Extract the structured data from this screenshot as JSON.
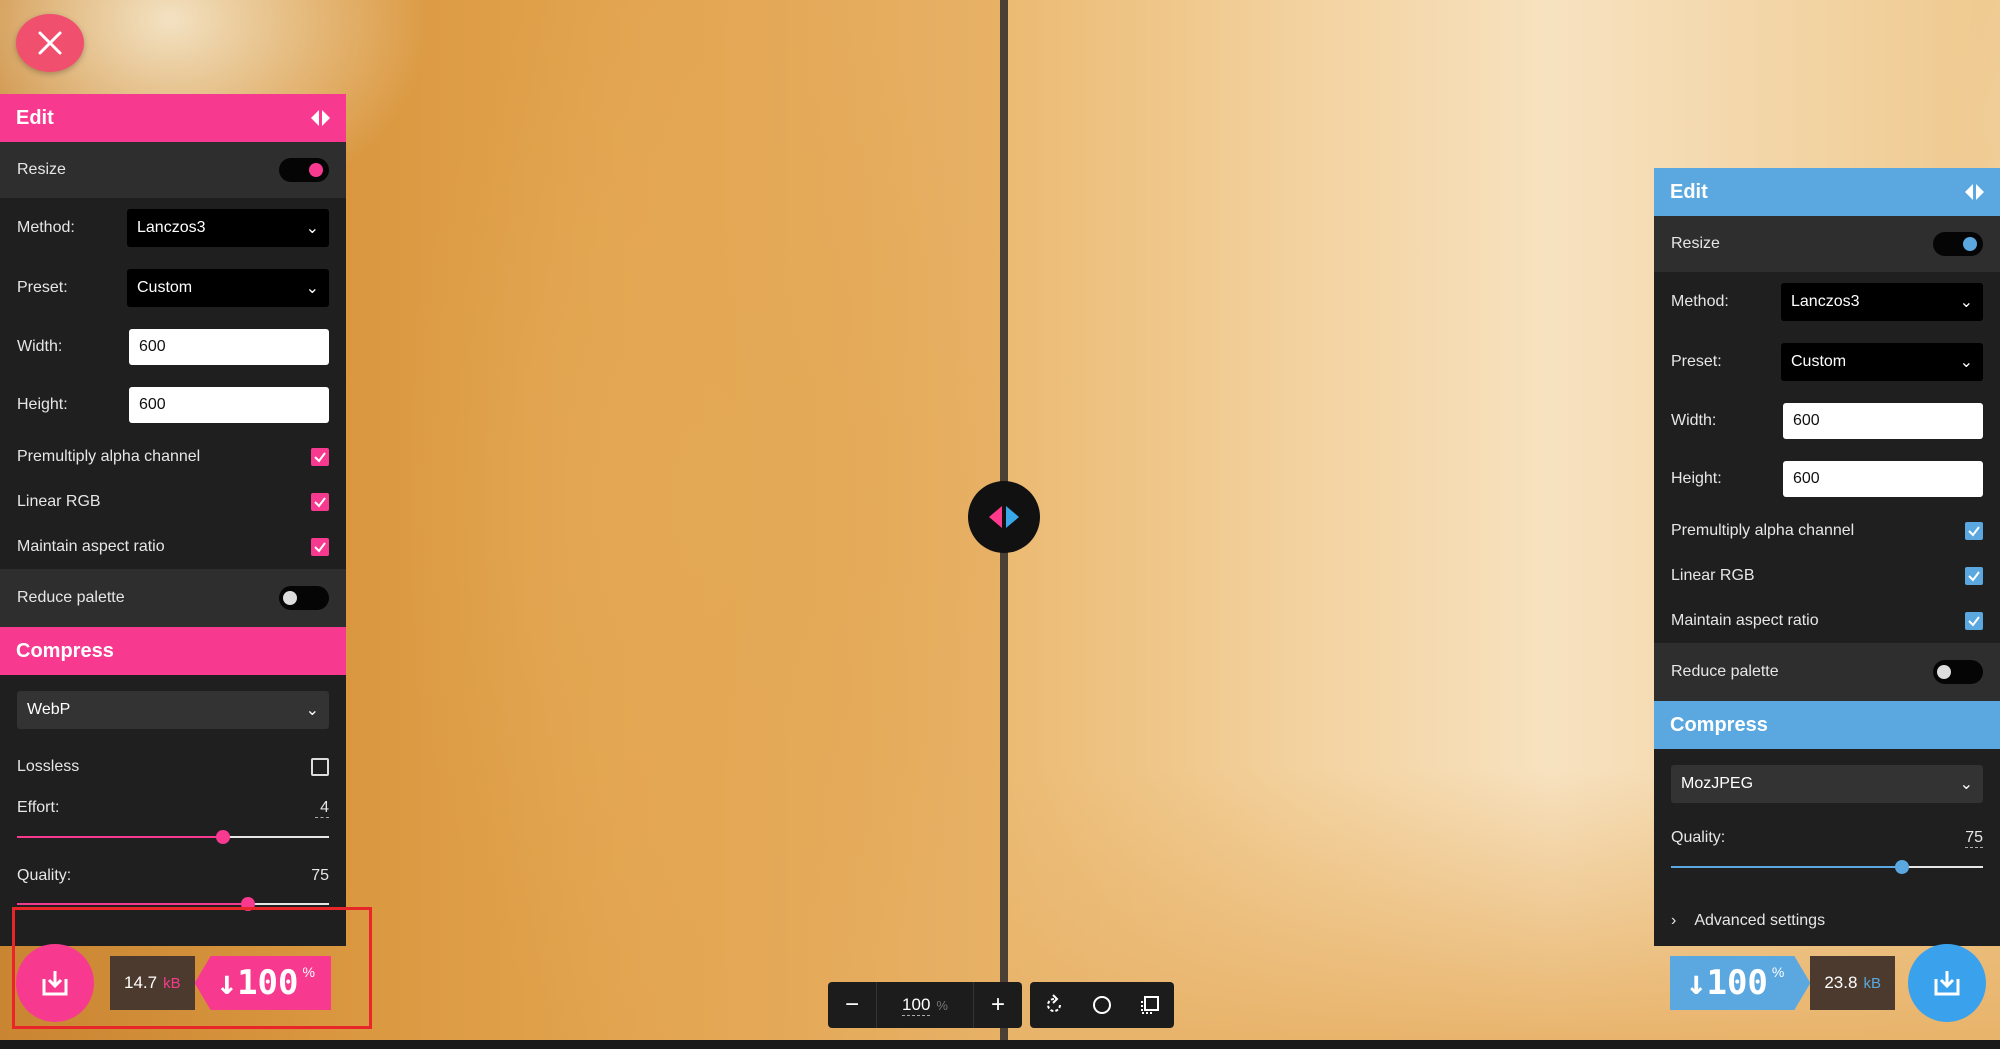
{
  "left": {
    "edit_title": "Edit",
    "resize_label": "Resize",
    "method_label": "Method:",
    "method_value": "Lanczos3",
    "preset_label": "Preset:",
    "preset_value": "Custom",
    "width_label": "Width:",
    "width_value": "600",
    "height_label": "Height:",
    "height_value": "600",
    "premultiply_label": "Premultiply alpha channel",
    "linear_rgb_label": "Linear RGB",
    "aspect_label": "Maintain aspect ratio",
    "reduce_palette_label": "Reduce palette",
    "compress_title": "Compress",
    "format_value": "WebP",
    "lossless_label": "Lossless",
    "effort_label": "Effort:",
    "effort_value": "4",
    "effort_fraction": 0.66,
    "quality_label": "Quality:",
    "quality_value": "75",
    "quality_fraction": 0.74,
    "size_value": "14.7",
    "size_unit": "kB",
    "percent_value": "↓100",
    "percent_sign": "%"
  },
  "right": {
    "edit_title": "Edit",
    "resize_label": "Resize",
    "method_label": "Method:",
    "method_value": "Lanczos3",
    "preset_label": "Preset:",
    "preset_value": "Custom",
    "width_label": "Width:",
    "width_value": "600",
    "height_label": "Height:",
    "height_value": "600",
    "premultiply_label": "Premultiply alpha channel",
    "linear_rgb_label": "Linear RGB",
    "aspect_label": "Maintain aspect ratio",
    "reduce_palette_label": "Reduce palette",
    "compress_title": "Compress",
    "format_value": "MozJPEG",
    "quality_label": "Quality:",
    "quality_value": "75",
    "quality_fraction": 0.74,
    "advanced_label": "Advanced settings",
    "size_value": "23.8",
    "size_unit": "kB",
    "percent_value": "↓100",
    "percent_sign": "%"
  },
  "zoom": {
    "minus": "−",
    "value": "100",
    "unit": "%",
    "plus": "+"
  },
  "colors": {
    "left_accent": "#f73a8f",
    "right_accent": "#5aa8df",
    "highlight": "#e8262a"
  }
}
